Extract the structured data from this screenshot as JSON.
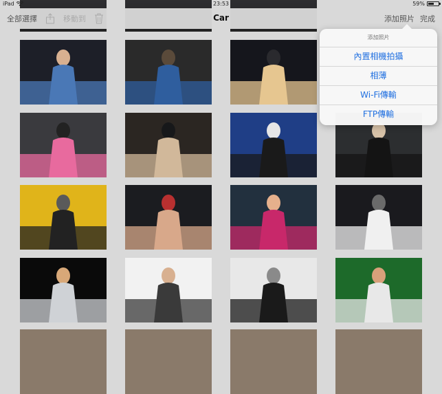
{
  "status_bar": {
    "device": "iPad",
    "time": "23:53",
    "battery": "59%",
    "battery_level": 0.59
  },
  "nav": {
    "select_all": "全部選擇",
    "move_to": "移動到",
    "title": "Car",
    "add_photo": "添加照片",
    "done": "完成"
  },
  "popover": {
    "title": "添加照片",
    "items": [
      "內置相機拍攝",
      "相薄",
      "Wi-Fi傳輸",
      "FTP傳輸"
    ]
  },
  "photos": [
    {
      "row": 0,
      "col": 0,
      "colors": [
        "#1d1f28",
        "#4a78b6",
        "#d8b090"
      ]
    },
    {
      "row": 0,
      "col": 1,
      "colors": [
        "#2a2a2a",
        "#2f5e9e",
        "#5a4a3a"
      ]
    },
    {
      "row": 0,
      "col": 2,
      "colors": [
        "#15161c",
        "#e6c690",
        "#2a2a2e"
      ]
    },
    {
      "row": 1,
      "col": 0,
      "colors": [
        "#3a3a3e",
        "#e86a9e",
        "#222"
      ]
    },
    {
      "row": 1,
      "col": 1,
      "colors": [
        "#2b2622",
        "#d1b89a",
        "#17181a"
      ]
    },
    {
      "row": 1,
      "col": 2,
      "colors": [
        "#1f3e86",
        "#1a1a1a",
        "#e6e6e6"
      ]
    },
    {
      "row": 1,
      "col": 3,
      "colors": [
        "#2c2e30",
        "#141414",
        "#d7c2a8"
      ]
    },
    {
      "row": 2,
      "col": 0,
      "colors": [
        "#e0b41a",
        "#222",
        "#5a5a5a"
      ]
    },
    {
      "row": 2,
      "col": 1,
      "colors": [
        "#1b1c20",
        "#d8a88a",
        "#b83030"
      ]
    },
    {
      "row": 2,
      "col": 2,
      "colors": [
        "#22303e",
        "#c8286a",
        "#e6b08c"
      ]
    },
    {
      "row": 2,
      "col": 3,
      "colors": [
        "#1a1a1e",
        "#f0f0f0",
        "#6a6a6a"
      ]
    },
    {
      "row": 3,
      "col": 0,
      "colors": [
        "#0a0a0a",
        "#cfd2d6",
        "#d8a878"
      ]
    },
    {
      "row": 3,
      "col": 1,
      "colors": [
        "#f2f2f2",
        "#3a3a3a",
        "#d8b090"
      ]
    },
    {
      "row": 3,
      "col": 2,
      "colors": [
        "#e8e8e8",
        "#1a1a1a",
        "#8a8a8a"
      ]
    },
    {
      "row": 3,
      "col": 3,
      "colors": [
        "#1d6a2a",
        "#e8e8e8",
        "#d8a07a"
      ]
    }
  ]
}
